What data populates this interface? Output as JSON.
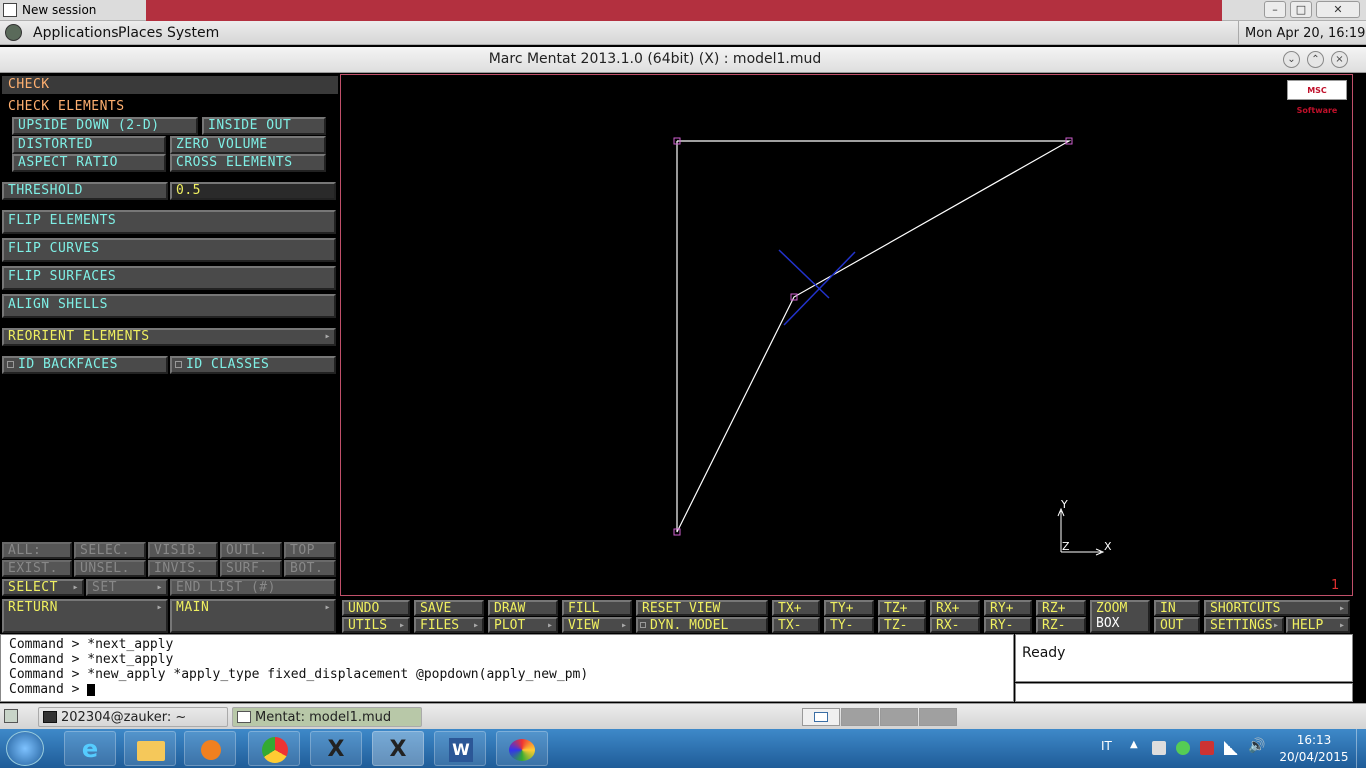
{
  "session": {
    "title": "New session"
  },
  "gnome": {
    "menus": [
      "Applications",
      "Places",
      "System"
    ],
    "clock": "Mon Apr 20, 16:19"
  },
  "app": {
    "title": "Marc Mentat 2013.1.0 (64bit) (X) : model1.mud",
    "logo": "MSC Software"
  },
  "panel": {
    "title": "CHECK",
    "check_header": "CHECK ELEMENTS",
    "check_buttons": [
      "UPSIDE DOWN (2-D)",
      "INSIDE OUT",
      "DISTORTED",
      "ZERO VOLUME",
      "ASPECT RATIO",
      "CROSS ELEMENTS"
    ],
    "threshold_label": "THRESHOLD",
    "threshold_value": "0.5",
    "flip_buttons": [
      "FLIP ELEMENTS",
      "FLIP CURVES",
      "FLIP SURFACES",
      "ALIGN SHELLS"
    ],
    "reorient": "REORIENT ELEMENTS",
    "id_backfaces": "ID BACKFACES",
    "id_classes": "ID CLASSES",
    "select_row1": [
      "ALL:",
      "SELEC.",
      "VISIB.",
      "OUTL.",
      "TOP"
    ],
    "select_row2": [
      "EXIST.",
      "UNSEL.",
      "INVIS.",
      "SURF.",
      "BOT."
    ],
    "select": "SELECT",
    "set": "SET",
    "end_list": "END LIST (#)",
    "return": "RETURN",
    "main": "MAIN"
  },
  "viewport": {
    "axis_x": "X",
    "axis_y": "Y",
    "axis_z": "Z",
    "viewport_number": "1"
  },
  "toolbar": {
    "row1": [
      "UNDO",
      "SAVE",
      "DRAW",
      "FILL",
      "RESET VIEW",
      "TX+",
      "TY+",
      "TZ+",
      "RX+",
      "RY+",
      "RZ+"
    ],
    "row2": [
      "UTILS",
      "FILES",
      "PLOT",
      "VIEW",
      "DYN. MODEL",
      "TX-",
      "TY-",
      "TZ-",
      "RX-",
      "RY-",
      "RZ-"
    ],
    "zoom": "ZOOM",
    "box": "BOX",
    "in": "IN",
    "out": "OUT",
    "shortcuts": "SHORTCUTS",
    "settings": "SETTINGS",
    "help": "HELP"
  },
  "command": {
    "prompt": "Command >",
    "history": [
      "*next_apply",
      "*next_apply",
      "*new_apply *apply_type fixed_displacement @popdown(apply_new_pm)"
    ],
    "current": ""
  },
  "status": {
    "text": "Ready"
  },
  "gnome_taskbar": {
    "terminal": "202304@zauker: ~",
    "mentat": "Mentat: model1.mud"
  },
  "windows": {
    "lang": "IT",
    "time": "16:13",
    "date": "20/04/2015"
  }
}
